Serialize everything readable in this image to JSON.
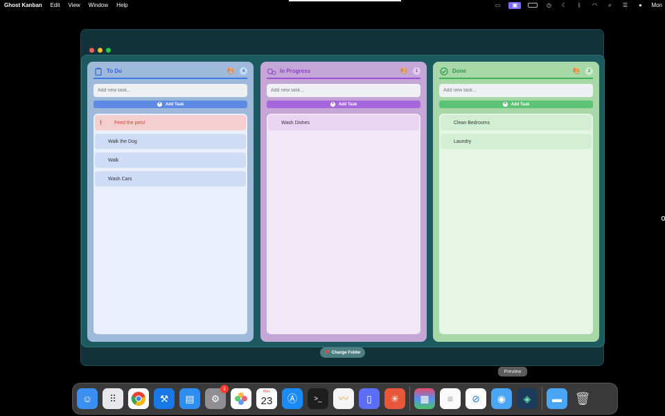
{
  "menubar": {
    "app_name": "Ghost Kanban",
    "items": [
      "Edit",
      "View",
      "Window",
      "Help"
    ],
    "clock": "Mon"
  },
  "board": {
    "columns": [
      {
        "title": "To Do",
        "count": "4",
        "input_placeholder": "Add new task...",
        "add_label": "Add Task",
        "tasks": [
          "Feed the pets!",
          "Walk the Dog",
          "Walk",
          "Wash Cars"
        ]
      },
      {
        "title": "In Progress",
        "count": "1",
        "input_placeholder": "Add new task...",
        "add_label": "Add Task",
        "tasks": [
          "Wash Dishes"
        ]
      },
      {
        "title": "Done",
        "count": "2",
        "input_placeholder": "Add new task...",
        "add_label": "Add Task",
        "tasks": [
          "Clean Bedrooms",
          "Laundry"
        ]
      }
    ],
    "change_folder_label": "Change Folder"
  },
  "dock": {
    "tooltip": "Preview",
    "settings_badge": "1",
    "calendar_month": "Mon",
    "calendar_day": "23"
  },
  "colors": {
    "todo_accent": "#2e63d8",
    "progress_accent": "#8a3ec5",
    "done_accent": "#2c9a48",
    "urgent": "#e03a3a"
  }
}
